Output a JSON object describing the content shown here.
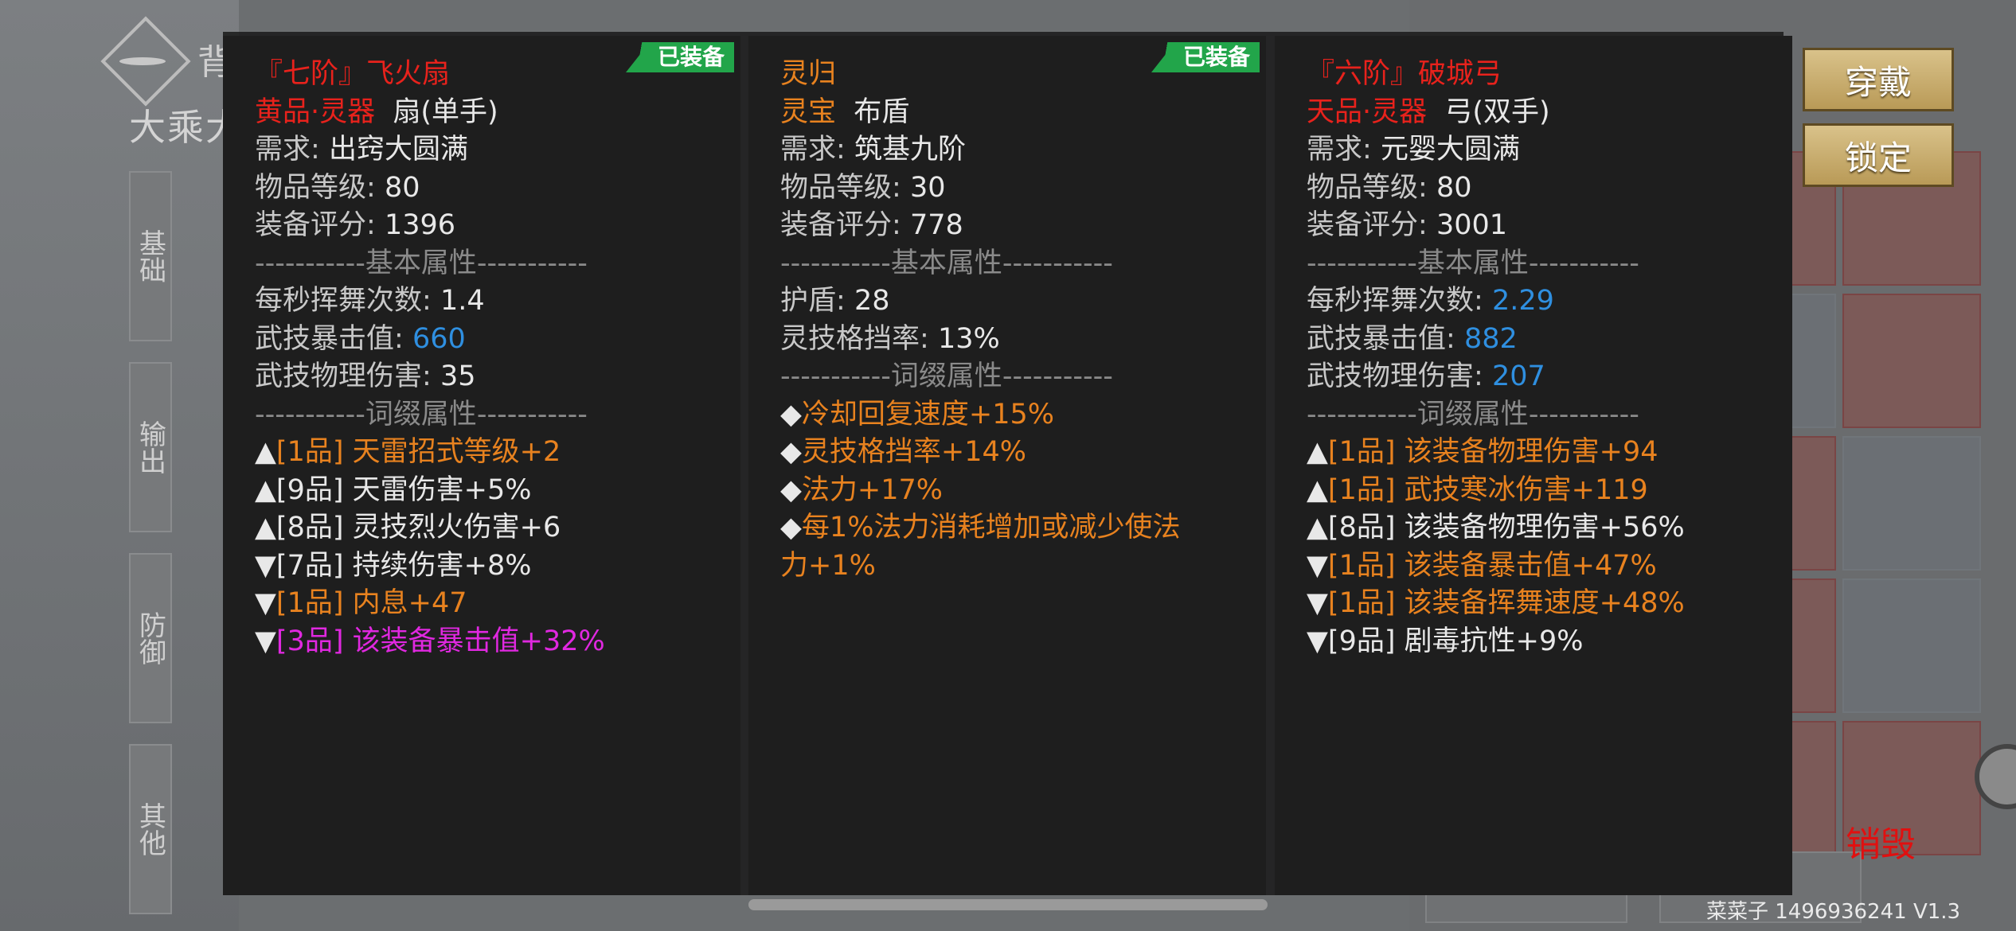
{
  "background": {
    "title": "背包",
    "rank": "大乘大",
    "side_tabs": [
      "基础",
      "输出",
      "防御",
      "其他"
    ],
    "footer_meta": "菜菜子 1496936241 V1.3",
    "destroy_label": "销毁"
  },
  "buttons": {
    "equip": "穿戴",
    "lock": "锁定"
  },
  "panels": [
    {
      "badge": "已装备",
      "name": "『七阶』飞火扇",
      "grade": "黄品·灵器",
      "type": "扇(单手)",
      "req_label": "需求:",
      "req": "出窍大圆满",
      "level_label": "物品等级:",
      "level": "80",
      "score_label": "装备评分:",
      "score": "1396",
      "base_sep": "-----------基本属性-----------",
      "base": [
        {
          "label": "每秒挥舞次数:",
          "value": "1.4",
          "color": "white"
        },
        {
          "label": "武技暴击值:",
          "value": "660",
          "color": "blue"
        },
        {
          "label": "武技物理伤害:",
          "value": "35",
          "color": "white"
        }
      ],
      "affix_sep": "-----------词缀属性-----------",
      "affixes": [
        {
          "mark": "▲",
          "tier": "[1品]",
          "text": "天雷招式等级+2",
          "color": "orange"
        },
        {
          "mark": "▲",
          "tier": "[9品]",
          "text": "天雷伤害+5%",
          "color": "white"
        },
        {
          "mark": "▲",
          "tier": "[8品]",
          "text": "灵技烈火伤害+6",
          "color": "white"
        },
        {
          "mark": "▼",
          "tier": "[7品]",
          "text": "持续伤害+8%",
          "color": "white"
        },
        {
          "mark": "▼",
          "tier": "[1品]",
          "text": "内息+47",
          "color": "orange"
        },
        {
          "mark": "▼",
          "tier": "[3品]",
          "text": "该装备暴击值+32%",
          "color": "magenta"
        }
      ]
    },
    {
      "badge": "已装备",
      "name": "灵归",
      "grade": "灵宝",
      "type": "布盾",
      "req_label": "需求:",
      "req": "筑基九阶",
      "level_label": "物品等级:",
      "level": "30",
      "score_label": "装备评分:",
      "score": "778",
      "base_sep": "-----------基本属性-----------",
      "base": [
        {
          "label": "护盾:",
          "value": "28",
          "color": "white"
        },
        {
          "label": "灵技格挡率:",
          "value": "13%",
          "color": "white"
        }
      ],
      "affix_sep": "-----------词缀属性-----------",
      "affixes": [
        {
          "mark": "◆",
          "tier": "",
          "text": "冷却回复速度+15%",
          "color": "orange"
        },
        {
          "mark": "◆",
          "tier": "",
          "text": "灵技格挡率+14%",
          "color": "orange"
        },
        {
          "mark": "◆",
          "tier": "",
          "text": "法力+17%",
          "color": "orange"
        },
        {
          "mark": "◆",
          "tier": "",
          "text": "每1%法力消耗增加或减少使法",
          "color": "orange"
        },
        {
          "mark": "",
          "tier": "",
          "text": "力+1%",
          "color": "orange"
        }
      ]
    },
    {
      "badge": "",
      "name": "『六阶』破城弓",
      "grade": "天品·灵器",
      "type": "弓(双手)",
      "req_label": "需求:",
      "req": "元婴大圆满",
      "level_label": "物品等级:",
      "level": "80",
      "score_label": "装备评分:",
      "score": "3001",
      "base_sep": "-----------基本属性-----------",
      "base": [
        {
          "label": "每秒挥舞次数:",
          "value": "2.29",
          "color": "blue"
        },
        {
          "label": "武技暴击值:",
          "value": "882",
          "color": "blue"
        },
        {
          "label": "武技物理伤害:",
          "value": "207",
          "color": "blue"
        }
      ],
      "affix_sep": "-----------词缀属性-----------",
      "affixes": [
        {
          "mark": "▲",
          "tier": "[1品]",
          "text": "该装备物理伤害+94",
          "color": "orange"
        },
        {
          "mark": "▲",
          "tier": "[1品]",
          "text": "武技寒冰伤害+119",
          "color": "orange"
        },
        {
          "mark": "▲",
          "tier": "[8品]",
          "text": "该装备物理伤害+56%",
          "color": "white"
        },
        {
          "mark": "▼",
          "tier": "[1品]",
          "text": "该装备暴击值+47%",
          "color": "orange"
        },
        {
          "mark": "▼",
          "tier": "[1品]",
          "text": "该装备挥舞速度+48%",
          "color": "orange"
        },
        {
          "mark": "▼",
          "tier": "[9品]",
          "text": "剧毒抗性+9%",
          "color": "white"
        }
      ]
    }
  ],
  "colors": {
    "name_red": "#e8221c",
    "orange": "#e8821f",
    "blue": "#2f8fe0",
    "magenta": "#e028e0",
    "badge_green": "#22a54a",
    "gold_button": "#c9ad6d"
  }
}
